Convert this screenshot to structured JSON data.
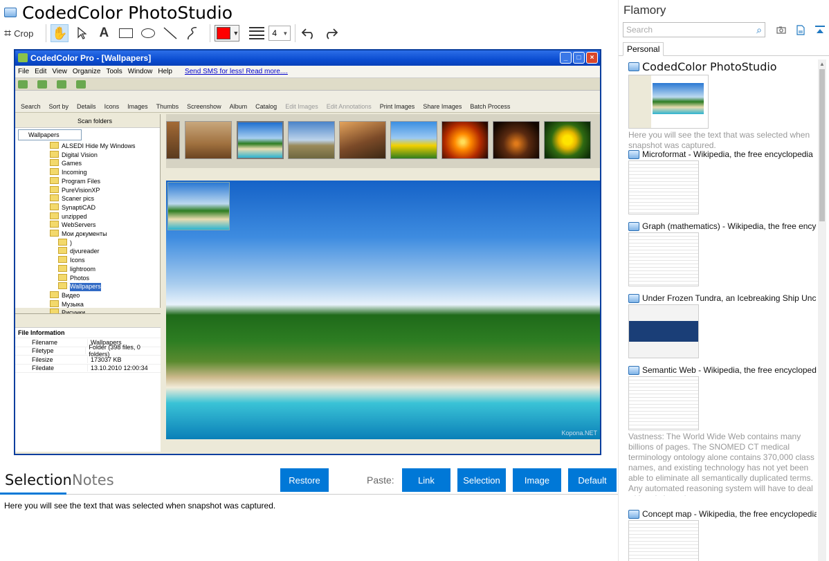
{
  "app": {
    "title": "CodedColor PhotoStudio"
  },
  "toolbar": {
    "crop_label": "Crop",
    "line_width": "4",
    "color": "#ff0000"
  },
  "snapshot": {
    "window_title": "CodedColor Pro - [Wallpapers]",
    "menu": [
      "File",
      "Edit",
      "View",
      "Organize",
      "Tools",
      "Window",
      "Help"
    ],
    "menu_link": "Send SMS for less! Read more....",
    "tools": [
      "Search",
      "Sort by",
      "Details",
      "Icons",
      "Images",
      "Thumbs",
      "Screenshow",
      "Album",
      "Catalog",
      "Edit Images",
      "Edit Annotations",
      "Print Images",
      "Share Images",
      "Batch Process"
    ],
    "scan_label": "Scan folders",
    "folder_combo": "Wallpapers",
    "folders": [
      "ALSEDI Hide My Windows",
      "Digital Vision",
      "Games",
      "Incoming",
      "Program Files",
      "PureVisionXP",
      "Scaner pics",
      "SynaptiCAD",
      "unzipped",
      "WebServers",
      "Мои документы",
      ")",
      "djvureader",
      "Icons",
      "lightroom",
      "Photos",
      "Wallpapers",
      "Видео",
      "Музыка",
      "Рисунки"
    ],
    "file_info_title": "File Information",
    "file_info": [
      {
        "k": "Filename",
        "v": "Wallpapers"
      },
      {
        "k": "Filetype",
        "v": "Folder (398 files, 0 folders)"
      },
      {
        "k": "Filesize",
        "v": "173037 KB"
      },
      {
        "k": "Filedate",
        "v": "13.10.2010 12:00:34"
      }
    ],
    "watermark": "Kopona.NET"
  },
  "bottom": {
    "tab_selection": "Selection",
    "tab_notes": "Notes",
    "restore": "Restore",
    "paste_label": "Paste:",
    "paste_link": "Link",
    "paste_selection": "Selection",
    "paste_image": "Image",
    "paste_default": "Default",
    "selection_text": "Here you will see the text that was selected when snapshot was captured."
  },
  "flamory": {
    "title": "Flamory",
    "search_placeholder": "Search",
    "tab": "Personal",
    "items": [
      {
        "title": "CodedColor PhotoStudio",
        "desc": "Here you will see the text that was selected when snapshot was captured."
      },
      {
        "title": "Microformat - Wikipedia, the free encyclopedia",
        "desc": ""
      },
      {
        "title": "Graph (mathematics) - Wikipedia, the free encyclopedia",
        "desc": ""
      },
      {
        "title": "Under Frozen Tundra, an Icebreaking Ship Uncovers",
        "desc": ""
      },
      {
        "title": "Semantic Web - Wikipedia, the free encyclopedia",
        "desc": "Vastness: The World Wide Web contains many billions of pages. The SNOMED CT medical terminology ontology alone contains 370,000 class names, and existing technology has not yet been able to eliminate all semantically duplicated terms. Any automated reasoning system will have to deal with truly huge inputs."
      },
      {
        "title": "Concept map - Wikipedia, the free encyclopedia",
        "desc": ""
      }
    ]
  }
}
